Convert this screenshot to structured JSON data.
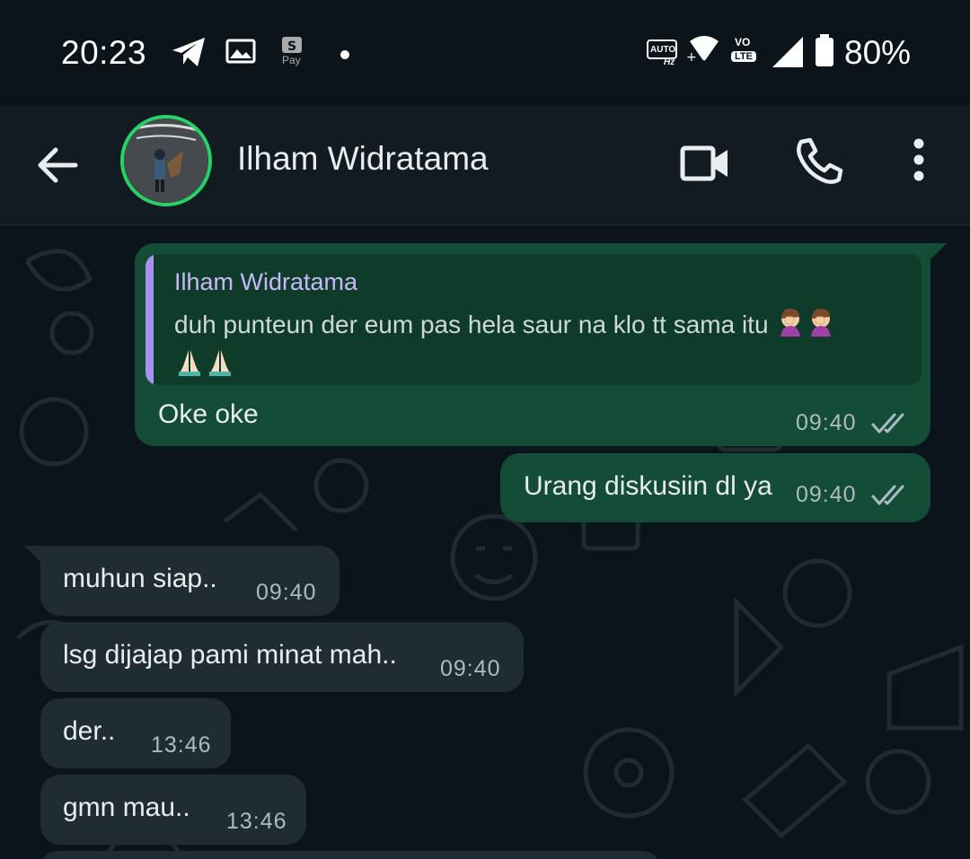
{
  "status_bar": {
    "time": "20:23",
    "battery_percent": "80%",
    "pay_label": "Pay",
    "auto_label": "AUTO",
    "hz_label": "Hz",
    "volte_label": "LTE",
    "vo_label": "VO"
  },
  "header": {
    "contact_name": "Ilham Widratama",
    "icons": [
      "back-arrow-icon",
      "video-call-icon",
      "phone-icon",
      "more-vert-icon"
    ]
  },
  "messages": [
    {
      "direction": "outgoing",
      "quoted": {
        "name": "Ilham Widratama",
        "text": "duh punteun der eum pas hela saur na klo tt sama itu"
      },
      "text": "Oke oke",
      "time": "09:40",
      "status": "delivered"
    },
    {
      "direction": "outgoing",
      "text": "Urang diskusiin dl ya",
      "time": "09:40",
      "status": "delivered"
    },
    {
      "direction": "incoming",
      "text": "muhun siap..",
      "time": "09:40"
    },
    {
      "direction": "incoming",
      "text": "lsg dijajap pami minat mah..",
      "time": "09:40"
    },
    {
      "direction": "incoming",
      "text": "der..",
      "time": "13:46"
    },
    {
      "direction": "incoming",
      "text": "gmn mau..",
      "time": "13:46"
    }
  ],
  "colors": {
    "background": "#0b141a",
    "header": "#121b22",
    "outgoing_bubble": "#144d37",
    "incoming_bubble": "#202c33",
    "quote_bar": "#a791f1",
    "avatar_ring": "#25d366"
  }
}
